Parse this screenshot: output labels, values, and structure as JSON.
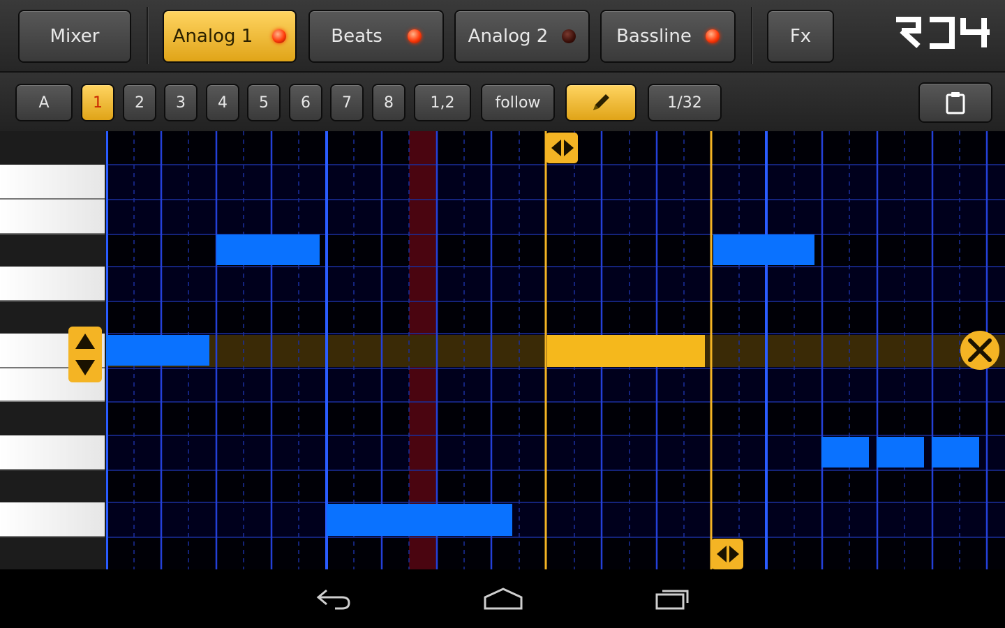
{
  "app": {
    "logo": "RD4"
  },
  "tabs": [
    {
      "label": "Mixer",
      "led": null,
      "active": false
    },
    {
      "label": "Analog 1",
      "led": "on",
      "active": true
    },
    {
      "label": "Beats",
      "led": "on",
      "active": false
    },
    {
      "label": "Analog 2",
      "led": "off",
      "active": false
    },
    {
      "label": "Bassline",
      "led": "on",
      "active": false
    },
    {
      "label": "Fx",
      "led": null,
      "active": false
    }
  ],
  "toolbar": {
    "pattern_buttons": [
      "A",
      "1",
      "2",
      "3",
      "4",
      "5",
      "6",
      "7",
      "8",
      "1,2"
    ],
    "active_pattern": "1",
    "follow_label": "follow",
    "pencil_icon": "pencil-icon",
    "resolution_label": "1/32",
    "clipboard_icon": "clipboard-icon"
  },
  "colors": {
    "accent": "#f4b424",
    "note": "#0a72ff",
    "selected_note": "#f5b81c",
    "grid_line": "#1e3bbd",
    "playhead": "#5a0612"
  },
  "navbar": {
    "icons": [
      "back-icon",
      "home-icon",
      "recent-apps-icon"
    ]
  }
}
